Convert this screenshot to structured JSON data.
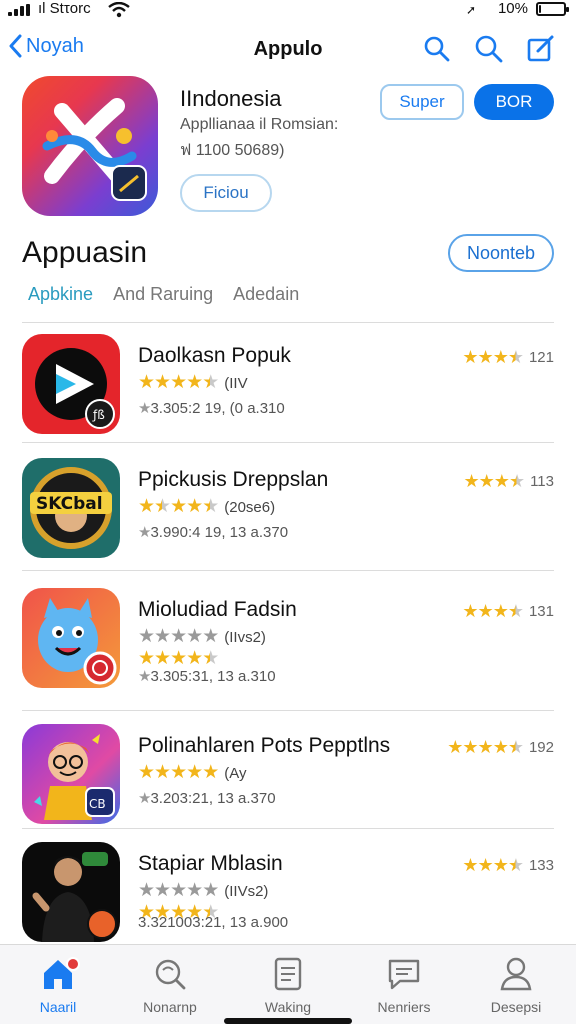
{
  "status_bar": {
    "carrier": "ıl Stτorc",
    "battery": "10%",
    "battery_level": 0.1
  },
  "nav": {
    "back_label": "Noyah",
    "title": "Appulo"
  },
  "header": {
    "app_title": "IIndonesia",
    "subtitle": "Appllianaa il Romsian:",
    "count": "ฟ 1100 50689)",
    "button_outline": "Super",
    "button_primary": "BOR",
    "button_pill": "Ficiou"
  },
  "section": {
    "title": "Appuasin",
    "action": "Noonteb",
    "tabs": [
      "Apbkine",
      "And Raruing",
      "Adedain"
    ]
  },
  "rows": [
    {
      "name": "Daolkasn Popuk",
      "rating_note": "(IIV",
      "meta": "3.305:2 19, (0 a.310",
      "right_count": "121"
    },
    {
      "name": "Ppickusis Dreppslan",
      "rating_note": "(20se6)",
      "meta": "3.990:4 19, 13 a.370",
      "right_count": "113"
    },
    {
      "name": "Mioludiad Fadsin",
      "rating_note": "(IIvs2)",
      "meta": "3.305:31, 13 a.310",
      "right_count": "131"
    },
    {
      "name": "Polinahlaren Pots Pepptlns",
      "rating_note": "(Ay",
      "meta": "3.203:21, 13 a.370",
      "right_count": "192"
    },
    {
      "name": "Stapiar Mblasin",
      "rating_note": "(IIVs2)",
      "meta": "3.321003:21, 13 a.900",
      "right_count": "133"
    }
  ],
  "tabbar": [
    "Naaril",
    "Nonarnp",
    "Waking",
    "Nenriers",
    "Desepsi"
  ],
  "colors": {
    "accent": "#1a7bf0",
    "star": "#f2b51b"
  }
}
